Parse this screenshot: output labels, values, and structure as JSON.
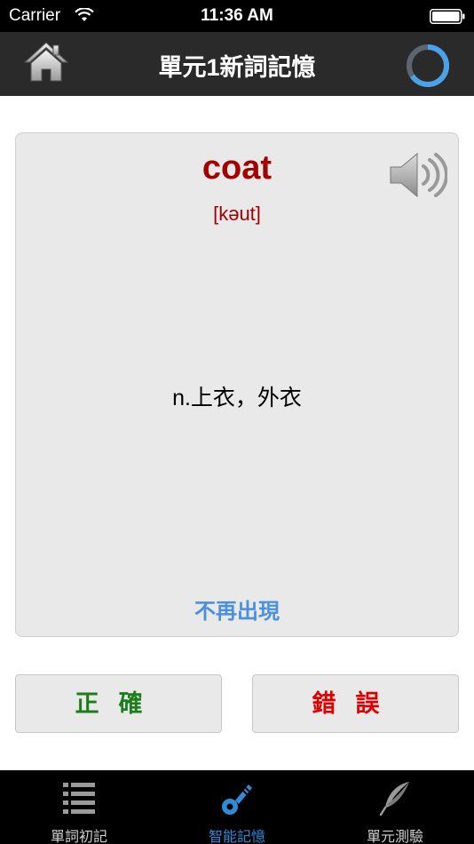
{
  "status_bar": {
    "carrier": "Carrier",
    "time": "11:36 AM"
  },
  "nav": {
    "title": "單元1新詞記憶",
    "home_icon": "home-icon",
    "progress_icon": "progress-ring-icon"
  },
  "card": {
    "word": "coat",
    "phonetic": "[kəut]",
    "meaning": "n.上衣，外衣",
    "no_show_label": "不再出現",
    "speaker_icon": "speaker-icon"
  },
  "answers": {
    "correct_label": "正確",
    "wrong_label": "錯誤"
  },
  "colors": {
    "word": "#a30000",
    "correct": "#1a7f1a",
    "wrong": "#e00000",
    "link": "#4a90e2",
    "tab_active": "#2f8ad8"
  },
  "tabs": [
    {
      "label": "單詞初記",
      "icon": "list-icon",
      "active": false
    },
    {
      "label": "智能記憶",
      "icon": "key-icon",
      "active": true
    },
    {
      "label": "單元測驗",
      "icon": "feather-icon",
      "active": false
    }
  ]
}
